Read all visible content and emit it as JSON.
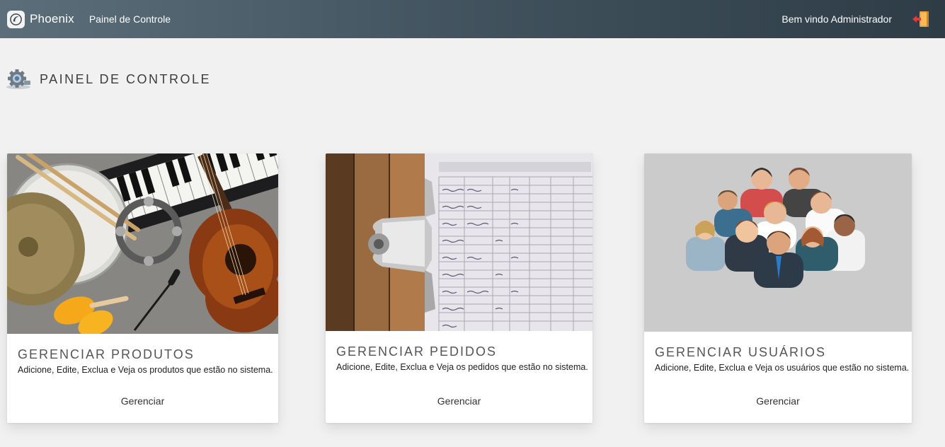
{
  "navbar": {
    "brand": "Phoenix",
    "nav_link": "Painel de Controle",
    "welcome": "Bem vindo Administrador",
    "logout_icon": "logout-door-icon"
  },
  "page": {
    "title": "PAINEL DE CONTROLE",
    "title_icon": "gear-settings-icon"
  },
  "cards": [
    {
      "image": "musical-instruments-photo",
      "title": "GERENCIAR PRODUTOS",
      "description": "Adicione, Edite, Exclua e Veja os produtos que estão no sistema.",
      "action": "Gerenciar"
    },
    {
      "image": "clipboard-orders-photo",
      "title": "GERENCIAR PEDIDOS",
      "description": "Adicione, Edite, Exclua e Veja os pedidos que estão no sistema.",
      "action": "Gerenciar"
    },
    {
      "image": "users-group-illustration",
      "title": "GERENCIAR USUÁRIOS",
      "description": "Adicione, Edite, Exclua e Veja os usuários que estão no sistema.",
      "action": "Gerenciar"
    }
  ]
}
